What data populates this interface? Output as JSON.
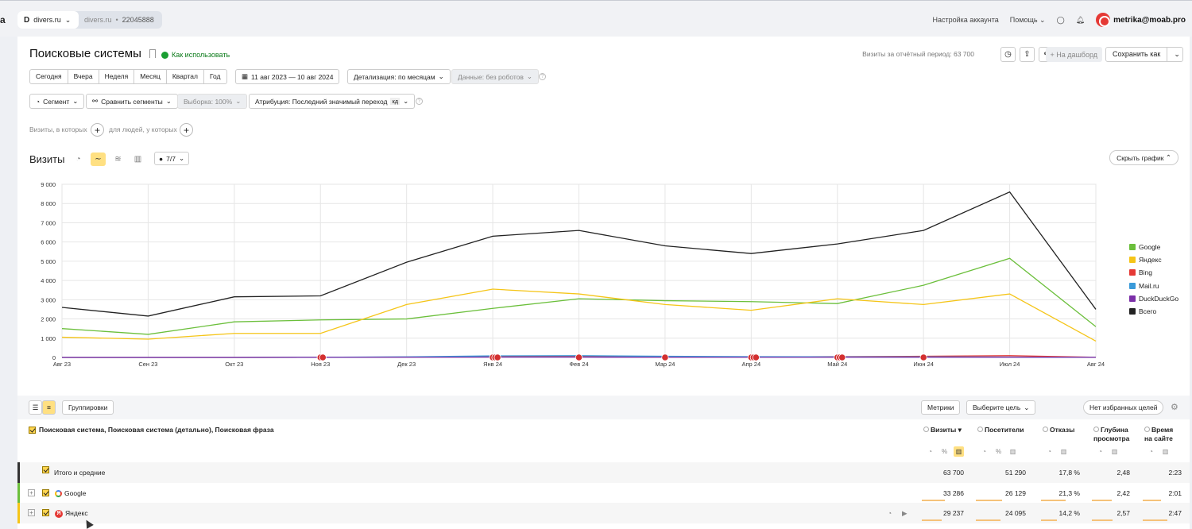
{
  "topbar": {
    "edge_logo": "a",
    "site_letter": "D",
    "site_name": "divers.ru",
    "site_domain": "divers.ru",
    "counter_id": "22045888",
    "account_settings": "Настройка аккаунта",
    "help": "Помощь",
    "user": "metrika@moab.pro"
  },
  "header": {
    "title": "Поисковые системы",
    "howto": "Как использовать",
    "visits_total": "Визиты за отчётный период: 63 700",
    "to_dashboard": "+ На дашборд",
    "save_as": "Сохранить как"
  },
  "periods": [
    "Сегодня",
    "Вчера",
    "Неделя",
    "Месяц",
    "Квартал",
    "Год"
  ],
  "filters": {
    "date_range": "11 авг 2023 — 10 авг 2024",
    "detail": "Детализация: по месяцам",
    "data": "Данные: без роботов",
    "segment": "Сегмент",
    "compare": "Сравнить сегменты",
    "sample": "Выборка: 100%",
    "attribution": "Атрибуция: Последний значимый переход",
    "attribution_tag": "кд",
    "visits_where": "Визиты, в которых",
    "people_where": "для людей, у которых"
  },
  "chart_header": {
    "title": "Визиты",
    "notes_count": "7/7",
    "hide_chart": "Скрыть график"
  },
  "chart_data": {
    "type": "line",
    "categories": [
      "Авг 23",
      "Сен 23",
      "Окт 23",
      "Ноя 23",
      "Дек 23",
      "Янв 24",
      "Фев 24",
      "Мар 24",
      "Апр 24",
      "Май 24",
      "Июн 24",
      "Июл 24",
      "Авг 24"
    ],
    "y_ticks": [
      "0",
      "1 000",
      "2 000",
      "3 000",
      "4 000",
      "5 000",
      "6 000",
      "7 000",
      "8 000",
      "9 000"
    ],
    "ylim": [
      0,
      9000
    ],
    "grid": true,
    "legend_position": "right",
    "series": [
      {
        "name": "Google",
        "color": "#6bbf3b",
        "values": [
          1500,
          1200,
          1850,
          1950,
          2000,
          2550,
          3050,
          2950,
          2900,
          2800,
          3750,
          5150,
          1600
        ]
      },
      {
        "name": "Яндекс",
        "color": "#f5c518",
        "values": [
          1050,
          950,
          1250,
          1250,
          2750,
          3550,
          3300,
          2750,
          2450,
          3050,
          2750,
          3300,
          850
        ]
      },
      {
        "name": "Bing",
        "color": "#e53935",
        "values": [
          0,
          0,
          0,
          10,
          20,
          40,
          40,
          30,
          30,
          40,
          60,
          90,
          10
        ]
      },
      {
        "name": "Mail.ru",
        "color": "#3a9ad9",
        "values": [
          0,
          0,
          0,
          10,
          30,
          80,
          90,
          60,
          40,
          30,
          30,
          20,
          5
        ]
      },
      {
        "name": "DuckDuckGo",
        "color": "#7b2fa8",
        "values": [
          0,
          0,
          0,
          5,
          10,
          15,
          15,
          10,
          10,
          10,
          10,
          10,
          5
        ]
      },
      {
        "name": "Всего",
        "color": "#222222",
        "values": [
          2600,
          2150,
          3150,
          3200,
          4950,
          6300,
          6600,
          5800,
          5400,
          5900,
          6600,
          8600,
          2500
        ]
      }
    ],
    "annotations": [
      {
        "x": "Ноя 23",
        "count": 2
      },
      {
        "x": "Янв 24",
        "count": 3
      },
      {
        "x": "Фев 24",
        "count": 1
      },
      {
        "x": "Мар 24",
        "count": 1
      },
      {
        "x": "Апр 24",
        "count": 3
      },
      {
        "x": "Май 24",
        "count": 3
      },
      {
        "x": "Июн 24",
        "count": 1
      }
    ]
  },
  "table": {
    "groupings": "Группировки",
    "metrics": "Метрики",
    "choose_goal": "Выберите цель",
    "no_fav_goals": "Нет избранных целей",
    "dimension_header": "Поисковая система, Поисковая система (детально), Поисковая фраза",
    "columns": [
      "Визиты",
      "Посетители",
      "Отказы",
      "Глубина просмотра",
      "Время на сайте"
    ],
    "column_lines": [
      [
        "Визиты"
      ],
      [
        "Посетители"
      ],
      [
        "Отказы"
      ],
      [
        "Глубина",
        "просмотра"
      ],
      [
        "Время",
        "на сайте"
      ]
    ],
    "rows": [
      {
        "label": "Итого и средние",
        "stripe": "#333333",
        "values": [
          "63 700",
          "51 290",
          "17,8 %",
          "2,48",
          "2:23"
        ],
        "bars": [
          1,
          1,
          1,
          1,
          1
        ]
      },
      {
        "label": "Google",
        "stripe": "#6bbf3b",
        "values": [
          "33 286",
          "26 129",
          "21,3 %",
          "2,42",
          "2:01"
        ],
        "bars": [
          0.52,
          0.51,
          0.6,
          0.5,
          0.45
        ]
      },
      {
        "label": "Яндекс",
        "stripe": "#f5c518",
        "values": [
          "29 237",
          "24 095",
          "14,2 %",
          "2,57",
          "2:47"
        ],
        "bars": [
          0.46,
          0.47,
          0.4,
          0.52,
          0.6
        ]
      }
    ]
  }
}
